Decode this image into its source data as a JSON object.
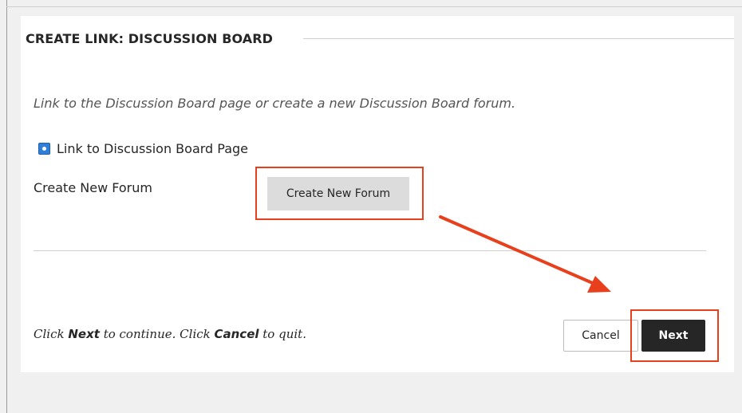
{
  "header": {
    "title": "CREATE LINK: DISCUSSION BOARD"
  },
  "content": {
    "instructions": "Link to the Discussion Board page or create a new Discussion Board forum.",
    "link_option_label": "Link to Discussion Board Page",
    "new_forum_label": "Create New Forum",
    "create_forum_button_label": "Create New Forum"
  },
  "footer": {
    "prefix": "Click ",
    "next_word": "Next",
    "middle": " to continue. Click ",
    "cancel_word": "Cancel",
    "suffix": " to quit.",
    "cancel_button_label": "Cancel",
    "next_button_label": "Next"
  },
  "colors": {
    "annotation_red": "#e8401c",
    "next_button_bg": "#262626",
    "radio_icon_blue": "#2f7fd9"
  },
  "icons": {
    "link_option_icon": "selected-radio-icon"
  }
}
